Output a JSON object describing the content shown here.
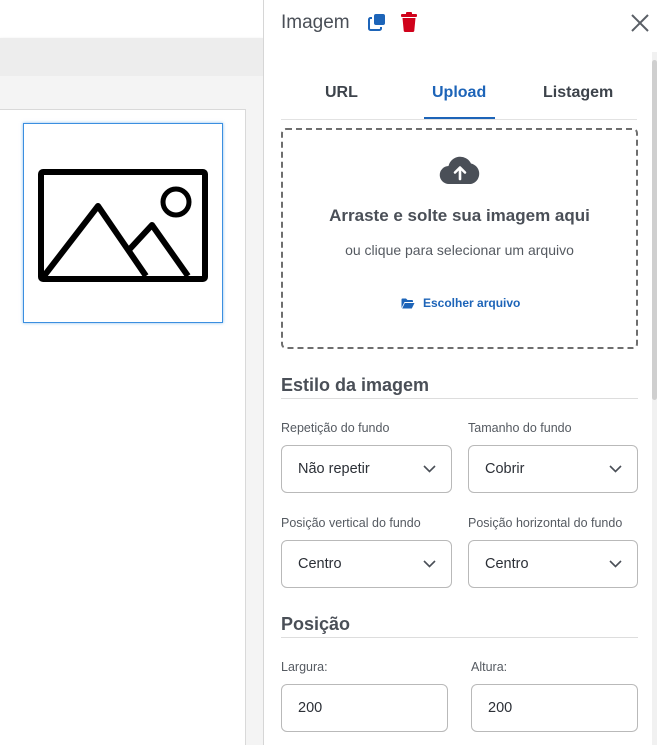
{
  "panel": {
    "title": "Imagem",
    "icons": {
      "duplicate": "duplicate-icon",
      "delete": "trash-icon",
      "close": "close-icon"
    },
    "colors": {
      "accent": "#1d64b8",
      "delete": "#d0021b"
    }
  },
  "tabs": [
    {
      "label": "URL",
      "active": false
    },
    {
      "label": "Upload",
      "active": true
    },
    {
      "label": "Listagem",
      "active": false
    }
  ],
  "upload": {
    "title": "Arraste e solte sua imagem aqui",
    "subtitle": "ou clique para selecionar um arquivo",
    "choose_label": "Escolher arquivo"
  },
  "style_section": {
    "title": "Estilo da imagem",
    "repeat": {
      "label": "Repetição do fundo",
      "value": "Não repetir"
    },
    "size": {
      "label": "Tamanho do fundo",
      "value": "Cobrir"
    },
    "vpos": {
      "label": "Posição vertical do fundo",
      "value": "Centro"
    },
    "hpos": {
      "label": "Posição horizontal do fundo",
      "value": "Centro"
    }
  },
  "position_section": {
    "title": "Posição",
    "width": {
      "label": "Largura:",
      "value": "200"
    },
    "height": {
      "label": "Altura:",
      "value": "200"
    }
  }
}
